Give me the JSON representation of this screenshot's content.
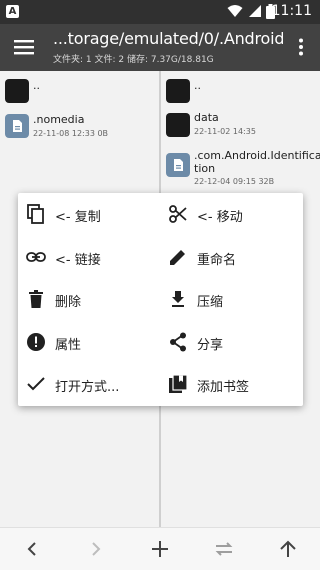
{
  "status_bar": {
    "app_icon_letter": "A",
    "time": "11:11",
    "icons": [
      "wifi-icon",
      "signal-icon",
      "battery-icon"
    ]
  },
  "app_bar": {
    "title": "...torage/emulated/0/.Android/",
    "subtitle": "文件夹: 1  文件: 2  储存: 7.37G/18.81G",
    "icons": [
      "menu-icon",
      "more-vert-icon"
    ]
  },
  "left_pane": {
    "items": [
      {
        "name": "..",
        "meta": "",
        "type": "folder"
      },
      {
        "name": ".nomedia",
        "meta": "22-11-08 12:33  0B",
        "type": "file"
      }
    ]
  },
  "right_pane": {
    "items": [
      {
        "name": "..",
        "meta": "",
        "type": "folder"
      },
      {
        "name": "data",
        "meta": "22-11-02 14:35",
        "type": "folder"
      },
      {
        "name_line1": ".com.Android.Identifica",
        "name_line2": "tion",
        "meta": "22-12-04 09:15  32B",
        "type": "file"
      }
    ]
  },
  "context_menu": {
    "items": [
      {
        "label": "<- 复制",
        "icon": "copy-icon"
      },
      {
        "label": "<- 移动",
        "icon": "scissors-icon"
      },
      {
        "label": "<- 链接",
        "icon": "link-icon"
      },
      {
        "label": "重命名",
        "icon": "pencil-icon"
      },
      {
        "label": "删除",
        "icon": "trash-icon"
      },
      {
        "label": "压缩",
        "icon": "download-icon"
      },
      {
        "label": "属性",
        "icon": "info-icon"
      },
      {
        "label": "分享",
        "icon": "share-icon"
      },
      {
        "label": "打开方式...",
        "icon": "check-icon"
      },
      {
        "label": "添加书签",
        "icon": "bookmark-icon"
      }
    ]
  },
  "bottom_bar": {
    "buttons": [
      "back-arrow-icon",
      "forward-arrow-icon",
      "add-icon",
      "swap-icon",
      "up-arrow-icon"
    ]
  },
  "colors": {
    "status_bar": "#303030",
    "app_bar": "#424242",
    "background": "#f2f2f2",
    "file_icon": "#6d8ba8",
    "menu_background": "#ffffff"
  }
}
